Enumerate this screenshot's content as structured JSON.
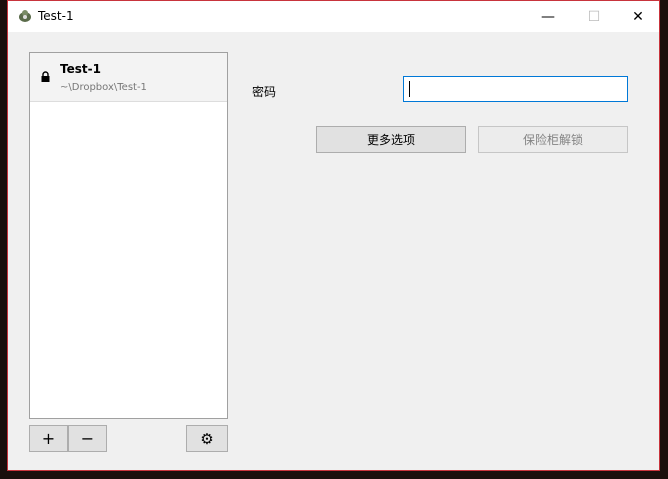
{
  "window": {
    "title": "Test-1",
    "minimize": "—",
    "maximize": "☐",
    "close": "✕"
  },
  "vaults": [
    {
      "name": "Test-1",
      "path": "~\\Dropbox\\Test-1",
      "locked": true
    }
  ],
  "list_buttons": {
    "add": "+",
    "remove": "−",
    "settings": "⚙"
  },
  "form": {
    "password_label": "密码",
    "password_value": "",
    "more_options": "更多选项",
    "unlock": "保险柜解锁"
  },
  "colors": {
    "focus": "#0078d7",
    "border": "#c8343c"
  }
}
